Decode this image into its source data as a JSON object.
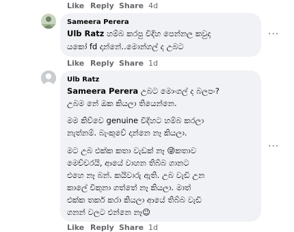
{
  "top_actions": {
    "like": "Like",
    "reply": "Reply",
    "share": "Share",
    "time": "4d"
  },
  "comment1": {
    "author": "Sameera Perera",
    "mention": "Ulb Ratz",
    "line1_rest": " හම්බ කරපු විදිහ පෙන්නල කවුද",
    "line2": "යකෝ fd දාන්නේ..මොන්ගල් ද උබට",
    "actions": {
      "like": "Like",
      "reply": "Reply",
      "share": "Share",
      "time": "1d"
    }
  },
  "comment2": {
    "author": "Ulb Ratz",
    "mention": "Sameera Perera",
    "lines": [
      " උබට මොංගල් ද බලපං?",
      "උබම නේ ඔක කියලා තියෙන්නෙ.",
      "",
      "මම කිව්වෙ genuine විදිහට හම්බ කරලා",
      "නැත්නම්. බැංකුවේ දාන්නෙ නෑ කියලා.",
      "",
      "මට උබ එක්ක කතා වැඩක් නෑ 😜කතාව",
      "මෙච්චරයි, ආයේ වාහන තිබ්බ ගානට",
      "එහෙ නෑ බන්. කයිවාරු ඇති. උබ වැඩි උන",
      "කාලේ විකුනා ගත්තේ නෑ කියලා. මාත්",
      "එක්ක තර්ක කරා කියලා ආයේ තිබ්බ වැඩි",
      "ගනන් වලට එන්නෙ නෑ😉"
    ],
    "actions": {
      "like": "Like",
      "reply": "Reply",
      "share": "Share",
      "time": "1d"
    }
  },
  "more_icon": "···"
}
